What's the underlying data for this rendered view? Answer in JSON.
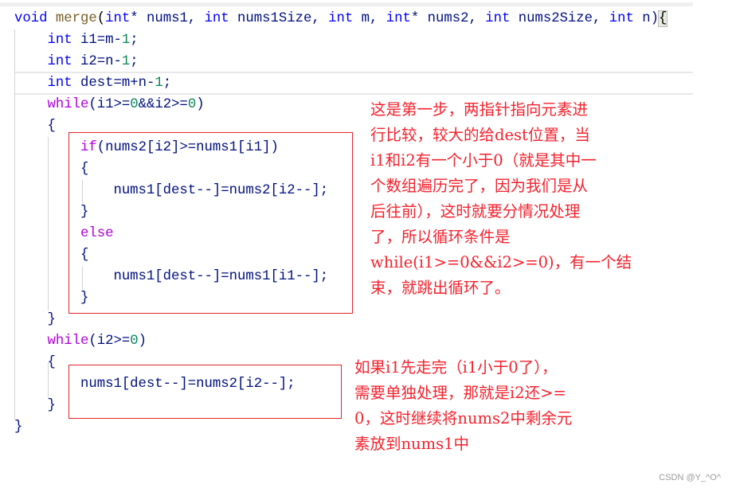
{
  "code_lines": [
    [
      [
        "void",
        "kw"
      ],
      [
        " ",
        "pl"
      ],
      [
        "merge",
        "fn"
      ],
      [
        "(",
        "pl"
      ],
      [
        "int",
        "kw"
      ],
      [
        "* nums1, ",
        "id"
      ],
      [
        "int",
        "kw"
      ],
      [
        " nums1Size, ",
        "id"
      ],
      [
        "int",
        "kw"
      ],
      [
        " m, ",
        "id"
      ],
      [
        "int",
        "kw"
      ],
      [
        "* nums2, ",
        "id"
      ],
      [
        "int",
        "kw"
      ],
      [
        " nums2Size, ",
        "id"
      ],
      [
        "int",
        "kw"
      ],
      [
        " n)",
        "id"
      ],
      [
        "{",
        "brace"
      ]
    ],
    [
      [
        "    ",
        "pl"
      ],
      [
        "int",
        "kw"
      ],
      [
        " i1=m-",
        "id"
      ],
      [
        "1",
        "num"
      ],
      [
        ";",
        "id"
      ]
    ],
    [
      [
        "    ",
        "pl"
      ],
      [
        "int",
        "kw"
      ],
      [
        " i2=n-",
        "id"
      ],
      [
        "1",
        "num"
      ],
      [
        ";",
        "id"
      ]
    ],
    [
      [
        "    ",
        "pl"
      ],
      [
        "int",
        "kw"
      ],
      [
        " dest=m+n-",
        "id"
      ],
      [
        "1",
        "num"
      ],
      [
        ";",
        "id"
      ]
    ],
    [
      [
        "    ",
        "pl"
      ],
      [
        "while",
        "ctl"
      ],
      [
        "(i1>=",
        "id"
      ],
      [
        "0",
        "num"
      ],
      [
        "&&i2>=",
        "id"
      ],
      [
        "0",
        "num"
      ],
      [
        ")",
        "id"
      ]
    ],
    [
      [
        "    {",
        "id"
      ]
    ],
    [
      [
        "        ",
        "pl"
      ],
      [
        "if",
        "ctl"
      ],
      [
        "(nums2[i2]>=nums1[i1])",
        "id"
      ]
    ],
    [
      [
        "        {",
        "id"
      ]
    ],
    [
      [
        "            nums1[dest--]=nums2[i2--];",
        "id"
      ]
    ],
    [
      [
        "        }",
        "id"
      ]
    ],
    [
      [
        "        ",
        "pl"
      ],
      [
        "else",
        "ctl"
      ]
    ],
    [
      [
        "        {",
        "id"
      ]
    ],
    [
      [
        "            nums1[dest--]=nums1[i1--];",
        "id"
      ]
    ],
    [
      [
        "        }",
        "id"
      ]
    ],
    [
      [
        "    }",
        "id"
      ]
    ],
    [
      [
        "    ",
        "pl"
      ],
      [
        "while",
        "ctl"
      ],
      [
        "(i2>=",
        "id"
      ],
      [
        "0",
        "num"
      ],
      [
        ")",
        "id"
      ]
    ],
    [
      [
        "    {",
        "id"
      ]
    ],
    [
      [
        "        nums1[dest--]=nums2[i2--];",
        "id"
      ]
    ],
    [
      [
        "    }",
        "id"
      ]
    ],
    [
      [
        "}",
        "id"
      ]
    ]
  ],
  "note1": [
    "这是第一步，两指针指向元素进",
    "行比较，较大的给dest位置，当",
    "i1和i2有一个小于0（就是其中一",
    "个数组遍历完了，因为我们是从",
    "后往前），这时就要分情况处理",
    "了，所以循环条件是",
    "while(i1>=0&&i2>=0)，有一个结",
    "束，就跳出循环了。"
  ],
  "note2": [
    "如果i1先走完（i1小于0了），",
    "需要单独处理，那就是i2还>=",
    "0，这时继续将nums2中剩余元",
    "素放到nums1中"
  ],
  "watermark": "CSDN @Y_^O^",
  "colors": {
    "keyword": "#0000ff",
    "function": "#795e26",
    "number": "#098658",
    "control": "#af00db",
    "identifier": "#001080",
    "annotation": "#f5222d",
    "box": "#e0262b"
  }
}
